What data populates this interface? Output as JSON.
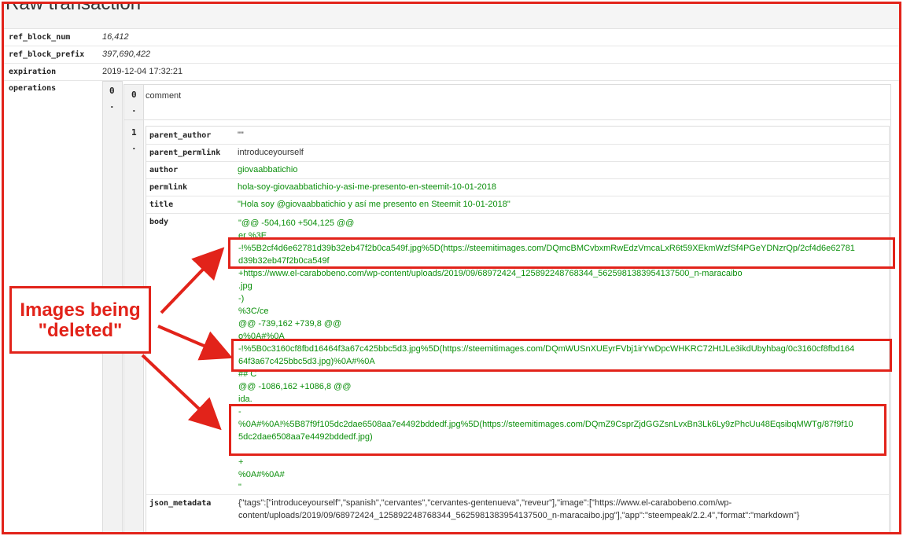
{
  "page": {
    "title": "Raw transaction"
  },
  "fields": {
    "ref_block_num": {
      "key": "ref_block_num",
      "value": "16,412"
    },
    "ref_block_prefix": {
      "key": "ref_block_prefix",
      "value": "397,690,422"
    },
    "expiration": {
      "key": "expiration",
      "value": "2019-12-04 17:32:21"
    },
    "operations": {
      "key": "operations"
    }
  },
  "operations": {
    "outer_index": "0\n.",
    "op0_index": "0\n.",
    "op0_value": "comment",
    "op1_index": "1\n.",
    "params": {
      "parent_author": {
        "key": "parent_author",
        "value": "\"\""
      },
      "parent_permlink": {
        "key": "parent_permlink",
        "value": "introduceyourself"
      },
      "author": {
        "key": "author",
        "value": "giovaabbatichio"
      },
      "permlink": {
        "key": "permlink",
        "value": "hola-soy-giovaabbatichio-y-asi-me-presento-en-steemit-10-01-2018"
      },
      "title": {
        "key": "title",
        "value": "\"Hola soy @giovaabbatichio y así me presento en Steemit 10-01-2018\""
      },
      "body": {
        "key": "body",
        "lines": [
          "\"@@ -504,160 +504,125 @@",
          "er %3E",
          "-!%5B2cf4d6e62781d39b32eb47f2b0ca549f.jpg%5D(https://steemitimages.com/DQmcBMCvbxmRwEdzVmcaLxR6t59XEkmWzfSf4PGeYDNzrQp/2cf4d6e62781",
          "d39b32eb47f2b0ca549f",
          "+https://www.el-carabobeno.com/wp-content/uploads/2019/09/68972424_125892248768344_5625981383954137500_n-maracaibo",
          ".jpg",
          "-)",
          "%3C/ce",
          "@@ -739,162 +739,8 @@",
          "o%0A#%0A",
          "-!%5B0c3160cf8fbd16464f3a67c425bbc5d3.jpg%5D(https://steemitimages.com/DQmWUSnXUEyrFVbj1irYwDpcWHKRC72HtJLe3ikdUbyhbag/0c3160cf8fbd164",
          "64f3a67c425bbc5d3.jpg)%0A#%0A",
          "## C",
          "@@ -1086,162 +1086,8 @@",
          "ida.",
          "-",
          "%0A#%0A!%5B87f9f105dc2dae6508aa7e4492bddedf.jpg%5D(https://steemitimages.com/DQmZ9CsprZjdGGZsnLvxBn3Lk6Ly9zPhcUu48EqsibqMWTg/87f9f10",
          "5dc2dae6508aa7e4492bddedf.jpg)",
          "",
          "+",
          "%0A#%0A#",
          "\""
        ]
      },
      "json_metadata": {
        "key": "json_metadata",
        "lines": [
          "{\"tags\":[\"introduceyourself\",\"spanish\",\"cervantes\",\"cervantes-gentenueva\",\"reveur\"],\"image\":[\"https://www.el-carabobeno.com/wp-",
          "content/uploads/2019/09/68972424_125892248768344_5625981383954137500_n-maracaibo.jpg\"],\"app\":\"steempeak/2.2.4\",\"format\":\"markdown\"}"
        ]
      }
    }
  },
  "annotation": {
    "line1": "Images being",
    "line2": "\"deleted\"",
    "color": "#e2231a"
  },
  "colors": {
    "value_green": "#0b8f0b",
    "annotation_red": "#e2231a"
  }
}
